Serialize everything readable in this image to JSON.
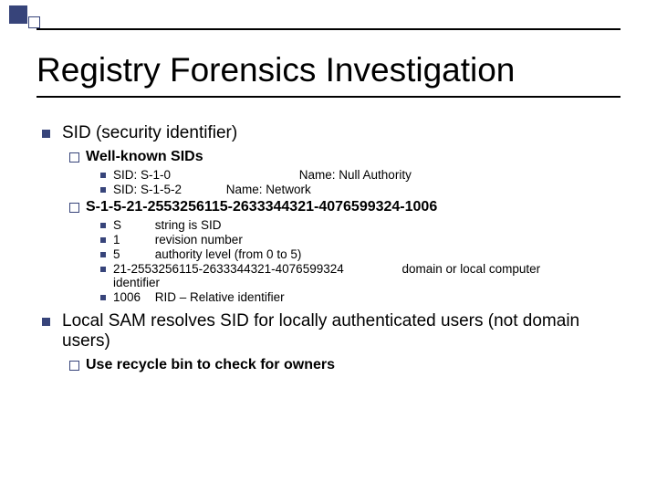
{
  "title": "Registry Forensics Investigation",
  "bullets": {
    "b1": {
      "text": "SID (security identifier)",
      "sub": {
        "s1": {
          "text": "Well-known SIDs",
          "items": {
            "i1_sid": "SID: S-1-0",
            "i1_name": "Name: Null Authority",
            "i2_sid": "SID: S-1-5-2",
            "i2_name": "Name: Network"
          }
        },
        "s2": {
          "text": "S-1-5-21-2553256115-2633344321-4076599324-1006",
          "items": {
            "p1_key": "S",
            "p1_desc": "string is SID",
            "p2_key": "1",
            "p2_desc": "revision number",
            "p3_key": "5",
            "p3_desc": "authority level (from 0 to 5)",
            "p4_key": "21-2553256115-2633344321-4076599324",
            "p4_desc": "domain or local computer identifier",
            "p5_key": "1006",
            "p5_desc": "RID – Relative identifier"
          }
        }
      }
    },
    "b2": {
      "text": "Local SAM resolves SID for locally authenticated users (not domain users)",
      "sub": {
        "s1": {
          "text": "Use recycle bin to check for owners"
        }
      }
    }
  }
}
